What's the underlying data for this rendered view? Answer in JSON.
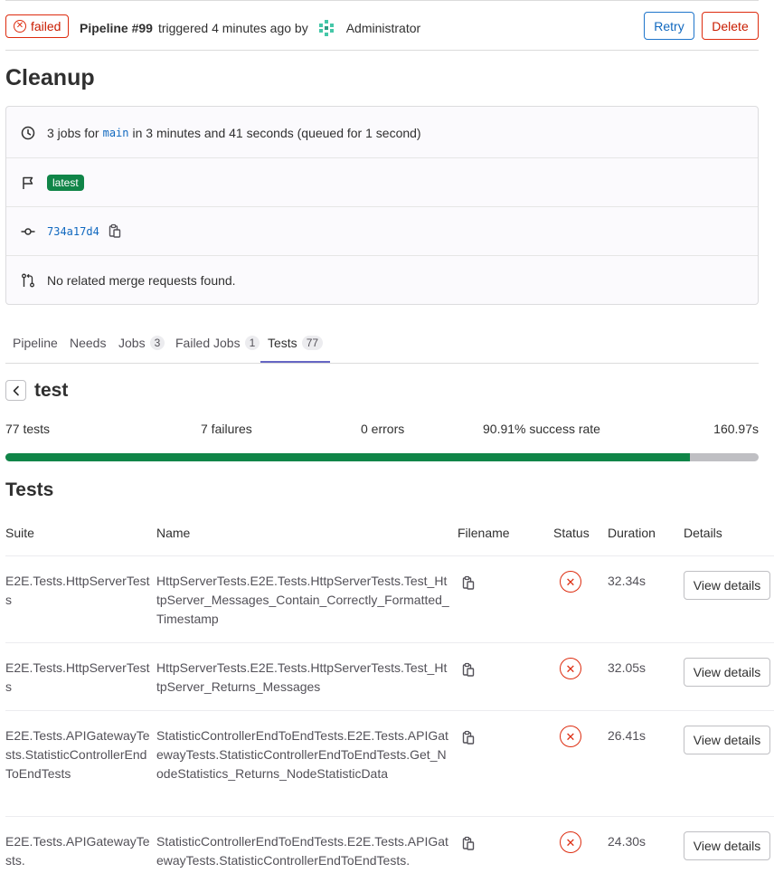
{
  "header": {
    "status_label": "failed",
    "pipeline_label": "Pipeline #99",
    "triggered_text": "triggered 4 minutes ago by",
    "user": "Administrator",
    "retry_label": "Retry",
    "delete_label": "Delete"
  },
  "page_title": "Cleanup",
  "info": {
    "jobs_prefix": "3 jobs for",
    "branch": "main",
    "jobs_suffix": "in 3 minutes and 41 seconds (queued for 1 second)",
    "tag": "latest",
    "commit_sha": "734a17d4",
    "merge_requests": "No related merge requests found."
  },
  "tabs": [
    {
      "label": "Pipeline",
      "count": ""
    },
    {
      "label": "Needs",
      "count": ""
    },
    {
      "label": "Jobs",
      "count": "3"
    },
    {
      "label": "Failed Jobs",
      "count": "1"
    },
    {
      "label": "Tests",
      "count": "77"
    }
  ],
  "job": {
    "name": "test",
    "total": "77 tests",
    "failures": "7 failures",
    "errors": "0 errors",
    "success_rate": "90.91% success rate",
    "duration": "160.97s",
    "success_fraction": 0.9091
  },
  "tests_heading": "Tests",
  "table": {
    "headers": [
      "Suite",
      "Name",
      "Filename",
      "Status",
      "Duration",
      "Details"
    ],
    "details_label": "View details",
    "rows": [
      {
        "suite": "E2E.Tests.HttpServerTests",
        "name": "HttpServerTests.E2E.Tests.HttpServerTests.Test_HttpServer_Messages_Contain_Correctly_Formatted_Timestamp",
        "duration": "32.34s"
      },
      {
        "suite": "E2E.Tests.HttpServerTests",
        "name": "HttpServerTests.E2E.Tests.HttpServerTests.Test_HttpServer_Returns_Messages",
        "duration": "32.05s"
      },
      {
        "suite": "E2E.Tests.APIGatewayTests.StatisticControllerEndToEndTests",
        "name": "StatisticControllerEndToEndTests.E2E.Tests.APIGatewayTests.StatisticControllerEndToEndTests.Get_NodeStatistics_Returns_NodeStatisticData",
        "duration": "26.41s"
      },
      {
        "suite": "E2E.Tests.APIGatewayTests.",
        "name": "StatisticControllerEndToEndTests.E2E.Tests.APIGatewayTests.StatisticControllerEndToEndTests.",
        "duration": "24.30s"
      }
    ]
  },
  "colors": {
    "danger": "#dd2b0e",
    "success": "#108548",
    "link": "#1068bf",
    "tab_active": "#6666c4"
  }
}
